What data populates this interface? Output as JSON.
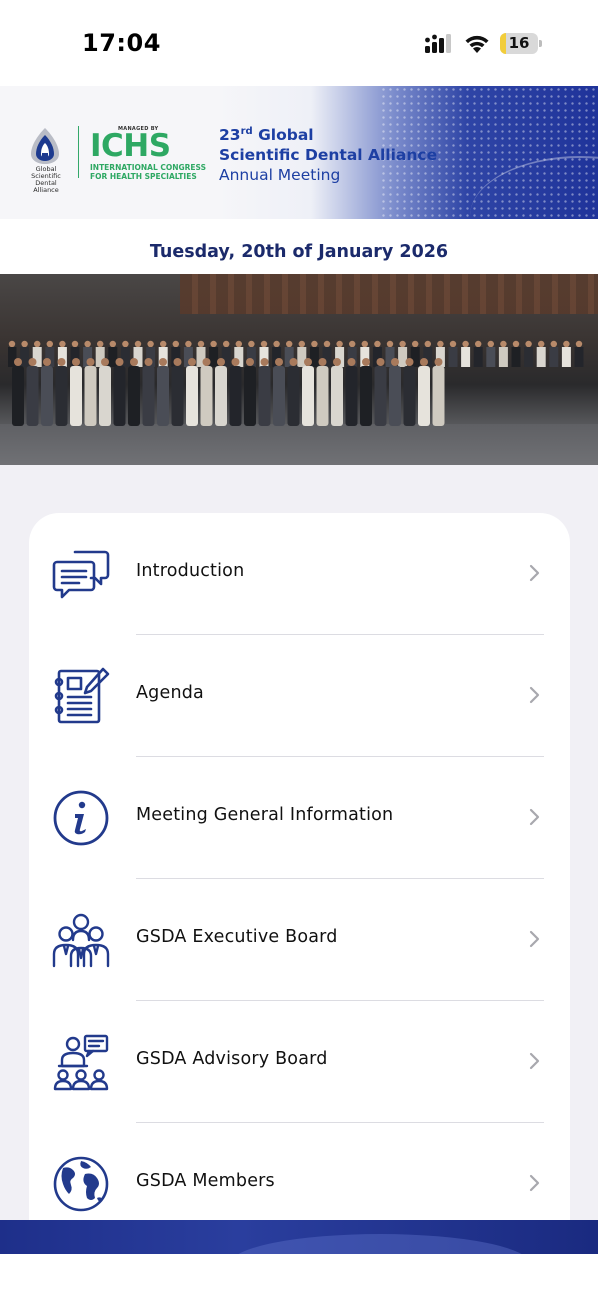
{
  "status_bar": {
    "time": "17:04",
    "battery_level": "16",
    "battery_fraction": 0.16,
    "signal_icon": "cellular-signal-icon",
    "wifi_icon": "wifi-icon"
  },
  "banner": {
    "gsda_logo_text": "Global Scientific Dental Alliance",
    "managed_by": "MANAGED BY",
    "ichs_mark": "ICHS",
    "ichs_subtitle_1": "INTERNATIONAL CONGRESS",
    "ichs_subtitle_2": "FOR HEALTH SPECIALTIES",
    "title_number": "23",
    "title_suffix": "rd",
    "title_line1_rest": " Global",
    "title_line2": "Scientific Dental Alliance",
    "title_line3": "Annual Meeting"
  },
  "date": "Tuesday, 20th of January 2026",
  "menu": {
    "items": [
      {
        "label": "Introduction",
        "icon": "chat-bubbles-icon"
      },
      {
        "label": "Agenda",
        "icon": "notebook-icon"
      },
      {
        "label": "Meeting General Information",
        "icon": "info-icon"
      },
      {
        "label": "GSDA Executive Board",
        "icon": "group-people-icon"
      },
      {
        "label": "GSDA Advisory Board",
        "icon": "presenter-audience-icon"
      },
      {
        "label": "GSDA Members",
        "icon": "globe-icon"
      }
    ]
  },
  "colors": {
    "brand_navy": "#1b2a6b",
    "brand_blue": "#1d3fa3",
    "ichs_green": "#2ea863",
    "icon_blue": "#223a8c",
    "background_gray": "#f1f0f5"
  }
}
